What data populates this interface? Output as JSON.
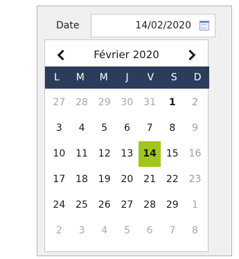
{
  "form": {
    "label": "Date",
    "value": "14/02/2020",
    "icon": "calendar-icon"
  },
  "calendar": {
    "month_label": "Février 2020",
    "prev_icon": "chevron-left-icon",
    "next_icon": "chevron-right-icon",
    "weekdays": [
      "L",
      "M",
      "M",
      "J",
      "V",
      "S",
      "D"
    ],
    "selected_color": "#a3c61a",
    "header_color": "#2c3d5b",
    "weeks": [
      [
        {
          "d": "27",
          "t": "muted"
        },
        {
          "d": "28",
          "t": "muted"
        },
        {
          "d": "29",
          "t": "muted"
        },
        {
          "d": "30",
          "t": "muted"
        },
        {
          "d": "31",
          "t": "muted"
        },
        {
          "d": "1",
          "t": "strong"
        },
        {
          "d": "2",
          "t": "weekend"
        }
      ],
      [
        {
          "d": "3",
          "t": ""
        },
        {
          "d": "4",
          "t": ""
        },
        {
          "d": "5",
          "t": ""
        },
        {
          "d": "6",
          "t": ""
        },
        {
          "d": "7",
          "t": ""
        },
        {
          "d": "8",
          "t": ""
        },
        {
          "d": "9",
          "t": "weekend"
        }
      ],
      [
        {
          "d": "10",
          "t": ""
        },
        {
          "d": "11",
          "t": ""
        },
        {
          "d": "12",
          "t": ""
        },
        {
          "d": "13",
          "t": ""
        },
        {
          "d": "14",
          "t": "selected"
        },
        {
          "d": "15",
          "t": ""
        },
        {
          "d": "16",
          "t": "weekend"
        }
      ],
      [
        {
          "d": "17",
          "t": ""
        },
        {
          "d": "18",
          "t": ""
        },
        {
          "d": "19",
          "t": ""
        },
        {
          "d": "20",
          "t": ""
        },
        {
          "d": "21",
          "t": ""
        },
        {
          "d": "22",
          "t": ""
        },
        {
          "d": "23",
          "t": "weekend"
        }
      ],
      [
        {
          "d": "24",
          "t": ""
        },
        {
          "d": "25",
          "t": ""
        },
        {
          "d": "26",
          "t": ""
        },
        {
          "d": "27",
          "t": ""
        },
        {
          "d": "28",
          "t": ""
        },
        {
          "d": "29",
          "t": ""
        },
        {
          "d": "1",
          "t": "muted"
        }
      ],
      [
        {
          "d": "2",
          "t": "muted"
        },
        {
          "d": "3",
          "t": "muted"
        },
        {
          "d": "4",
          "t": "muted"
        },
        {
          "d": "5",
          "t": "muted"
        },
        {
          "d": "6",
          "t": "muted"
        },
        {
          "d": "7",
          "t": "muted"
        },
        {
          "d": "8",
          "t": "muted"
        }
      ]
    ]
  }
}
